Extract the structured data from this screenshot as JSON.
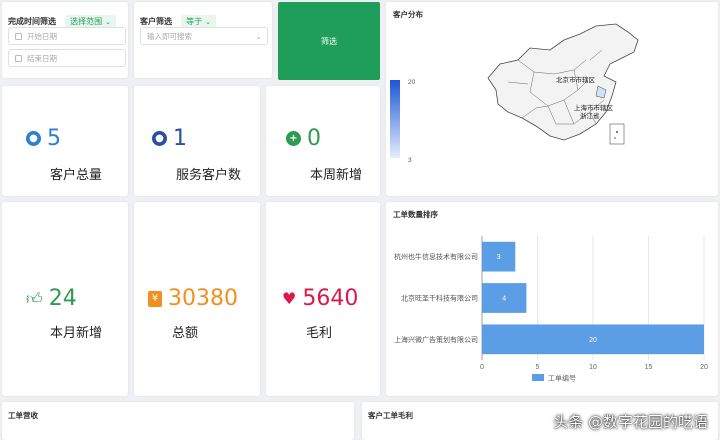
{
  "filters": {
    "time_filter_label": "完成时间筛选",
    "time_range_tag": "选择范围",
    "start_date_placeholder": "开始日期",
    "end_date_placeholder": "结束日期",
    "customer_filter_label": "客户筛选",
    "customer_op_tag": "等于",
    "customer_search_placeholder": "输入即可搜索",
    "filter_button_label": "筛选"
  },
  "kpis": [
    {
      "value": "5",
      "label": "客户总量",
      "icon": "user-circle-icon",
      "color": "#2e7fd1"
    },
    {
      "value": "1",
      "label": "服务客户数",
      "icon": "user-circle-icon",
      "color": "#2a4fa0"
    },
    {
      "value": "0",
      "label": "本周新增",
      "icon": "plus-circle-icon",
      "color": "#2e9b4f"
    },
    {
      "value": "24",
      "label": "本月新增",
      "icon": "thumbs-up-icon",
      "color": "#2e9b4f"
    },
    {
      "value": "30380",
      "label": "总额",
      "icon": "yuan-wallet-icon",
      "color": "#f0901e"
    },
    {
      "value": "5640",
      "label": "毛利",
      "icon": "heart-icon",
      "color": "#d81b4a"
    }
  ],
  "map": {
    "title": "客户分布",
    "legend_max": "20",
    "legend_min": "3",
    "labels": [
      "北京市市辖区",
      "上海市市辖区",
      "浙江省"
    ]
  },
  "ranking": {
    "title": "工单数量排序",
    "legend": "工单编号"
  },
  "bottom": {
    "left_title": "工单营收",
    "right_title": "客户工单毛利"
  },
  "watermark": "头条 @数字花园的呓语",
  "chart_data": {
    "type": "bar",
    "orientation": "horizontal",
    "title": "工单数量排序",
    "categories": [
      "杭州也牛信息技术有限公司",
      "北京旺圣千科技有限公司",
      "上海兴微广告策划有限公司"
    ],
    "series": [
      {
        "name": "工单编号",
        "values": [
          3,
          4,
          20
        ]
      }
    ],
    "xlim": [
      0,
      20
    ],
    "xticks": [
      0,
      5,
      10,
      15,
      20
    ],
    "grid": true,
    "legend_position": "bottom"
  },
  "colors": {
    "accent_green": "#1f9d5a",
    "bar_blue": "#5b9ee6",
    "map_fill": "#f3f3f3"
  }
}
